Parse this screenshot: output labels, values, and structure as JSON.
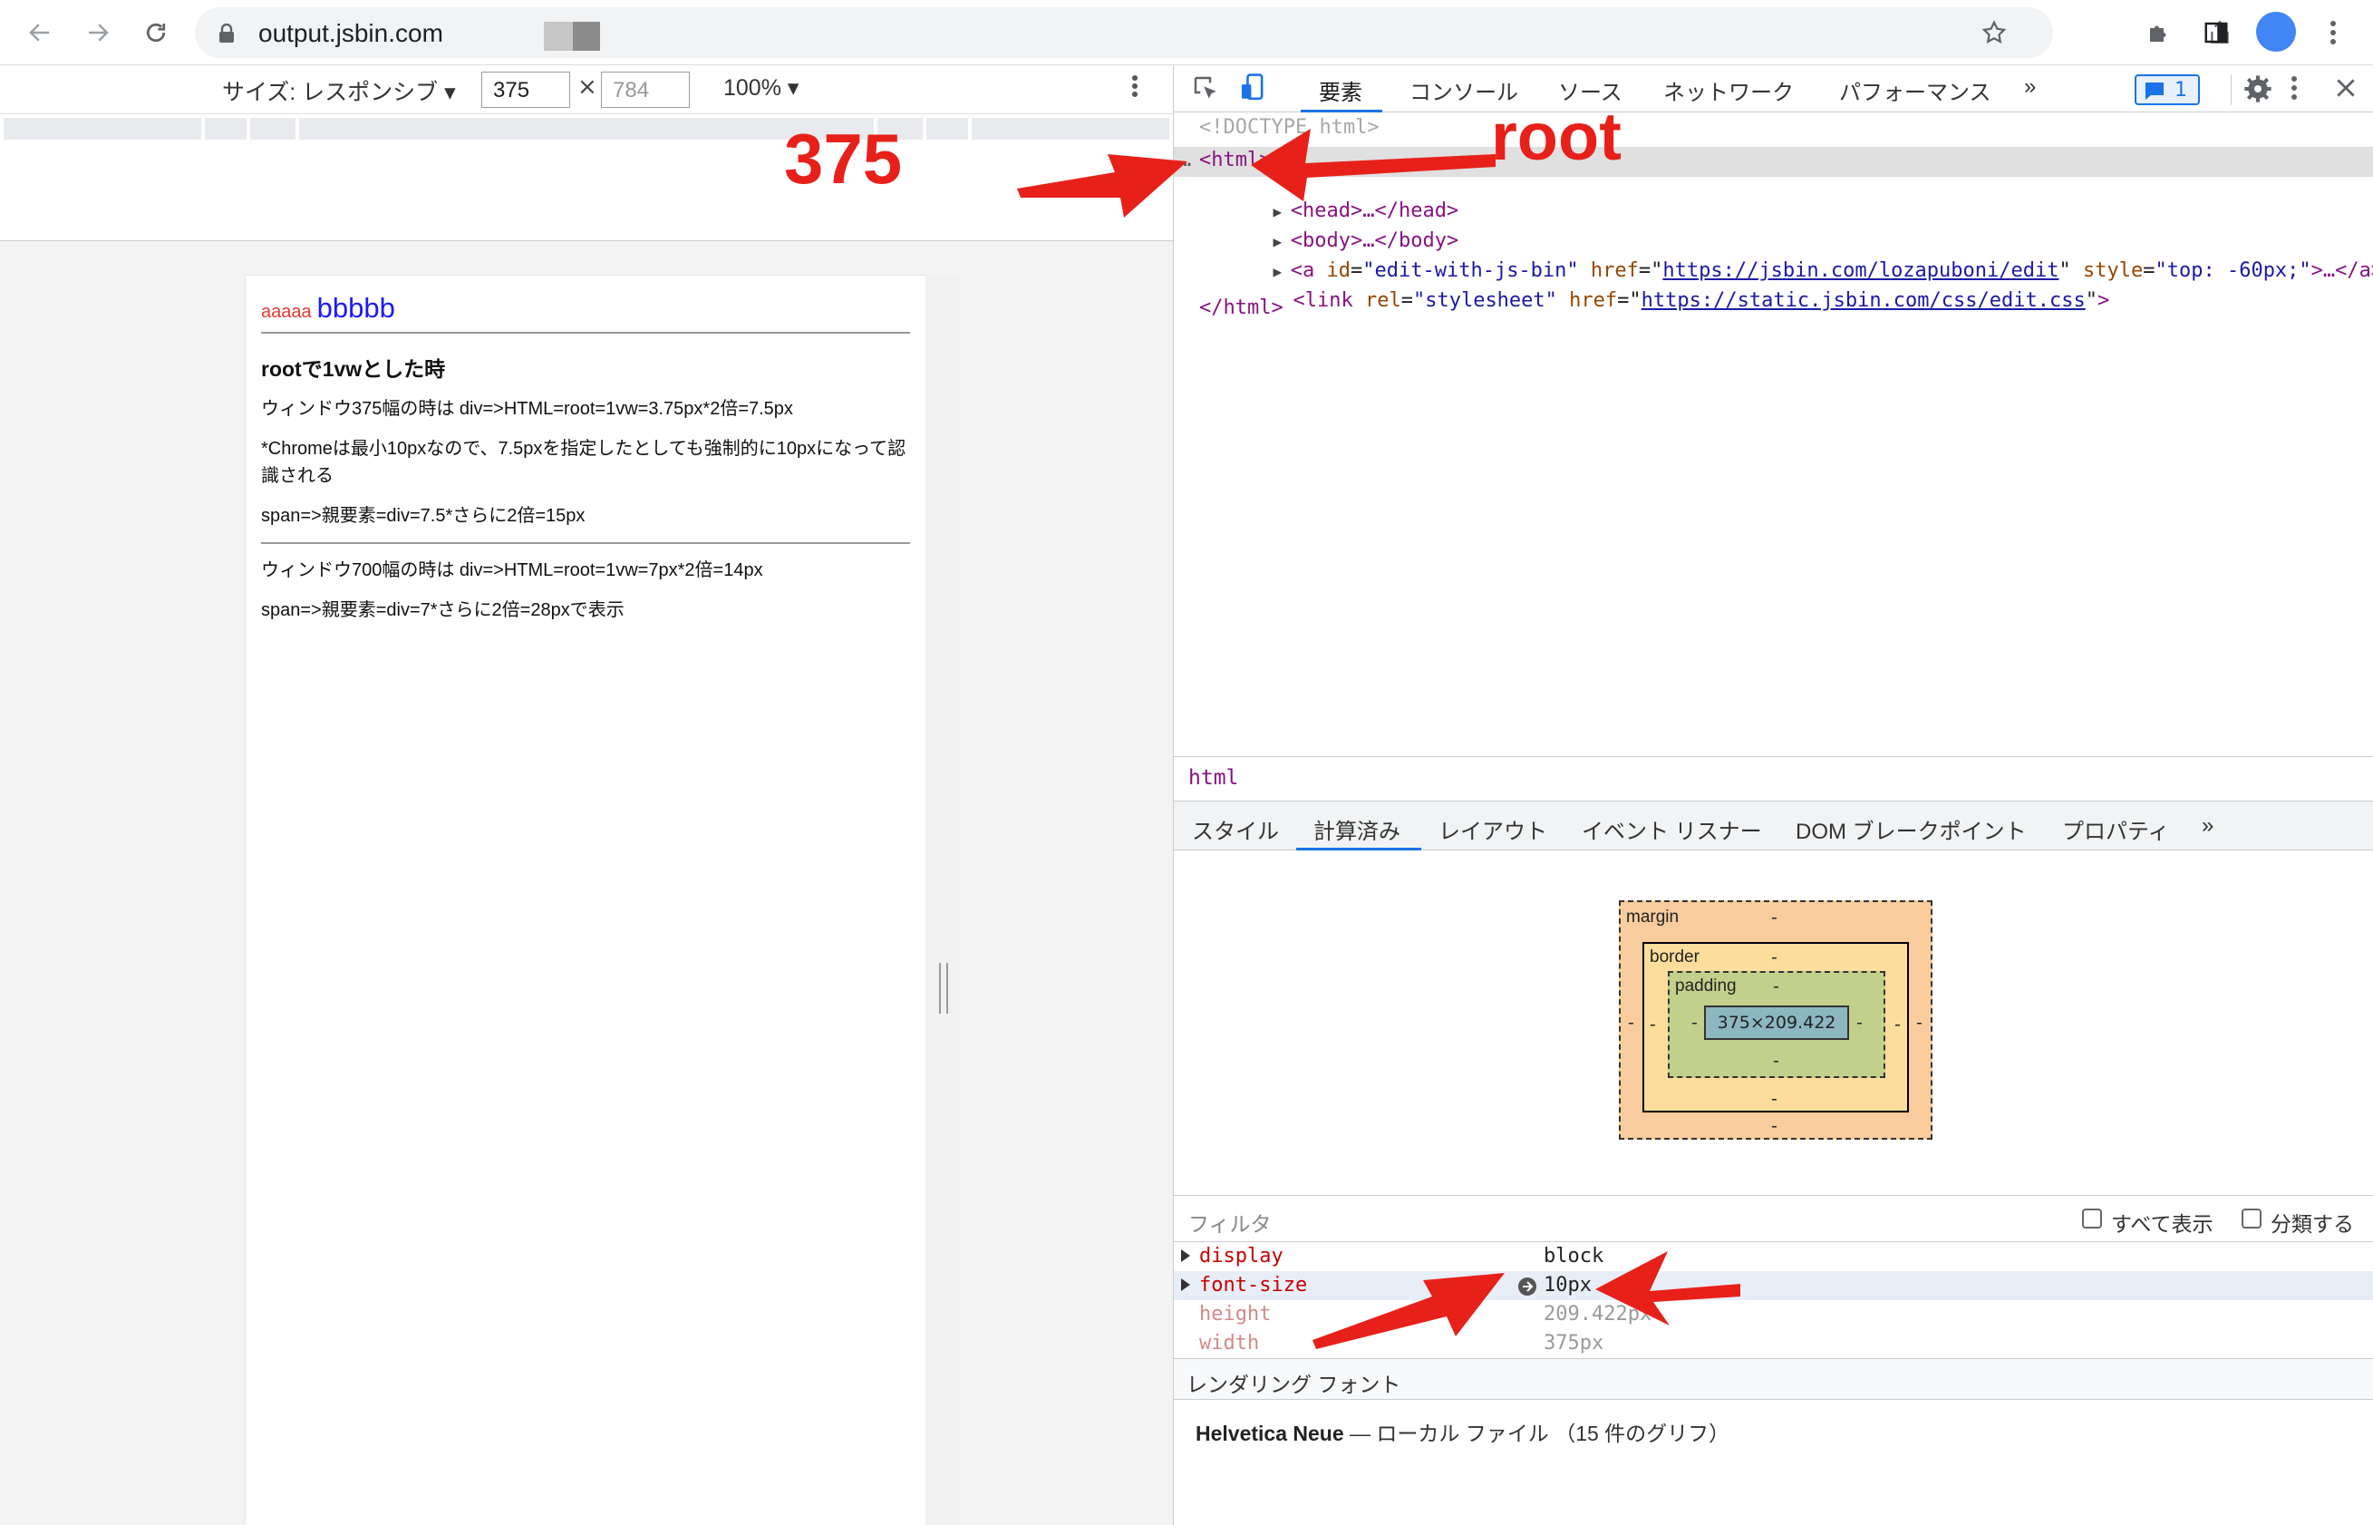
{
  "browser": {
    "url": "output.jsbin.com"
  },
  "device_toolbar": {
    "size_label": "サイズ: レスポンシブ ▾",
    "width": "375",
    "height_placeholder": "784",
    "times": "×",
    "zoom": "100% ▾"
  },
  "page": {
    "title_small": "aaaaa",
    "title_big": "bbbbb",
    "heading": "rootで1vwとした時",
    "line1": "ウィンドウ375幅の時は div=>HTML=root=1vw=3.75px*2倍=7.5px",
    "line2": "*Chromeは最小10pxなので、7.5pxを指定したとしても強制的に10pxになって認識される",
    "line3": "span=>親要素=div=7.5*さらに2倍=15px",
    "line4": "ウィンドウ700幅の時は div=>HTML=root=1vw=7px*2倍=14px",
    "line5": "span=>親要素=div=7*さらに2倍=28pxで表示"
  },
  "devtools": {
    "tabs": [
      "要素",
      "コンソール",
      "ソース",
      "ネットワーク",
      "パフォーマンス",
      "»"
    ],
    "issues_count": "1",
    "dom": {
      "doctype": "<!DOCTYPE html>",
      "html_open": "<html>",
      "head": "<head>…</head>",
      "body": "<body>…</body>",
      "a_prefix": "<a ",
      "a_id_attr": "id",
      "a_id_val": "\"edit-with-js-bin\"",
      "a_href_attr": "href",
      "a_href_val": "https://jsbin.com/lozapuboni/edit",
      "a_style_attr": "style",
      "a_style_val": "\"top: -60px;\"",
      "a_suffix": ">…</a>",
      "link_prefix": "<link ",
      "link_rel_attr": "rel",
      "link_rel_val": "\"stylesheet\"",
      "link_href_attr": "href",
      "link_href_val": "https://static.jsbin.com/css/edit.css",
      "link_suffix": ">",
      "html_close": "</html>"
    },
    "breadcrumb": "html",
    "subtabs": [
      "スタイル",
      "計算済み",
      "レイアウト",
      "イベント リスナー",
      "DOM ブレークポイント",
      "プロパティ",
      "»"
    ],
    "box_model": {
      "margin_label": "margin",
      "border_label": "border",
      "padding_label": "padding",
      "content": "375×209.422",
      "dash": "-"
    },
    "filter": {
      "placeholder": "フィルタ",
      "show_all": "すべて表示",
      "group": "分類する"
    },
    "computed": [
      {
        "name": "display",
        "value": "block"
      },
      {
        "name": "font-size",
        "value": "10px"
      },
      {
        "name": "height",
        "value": "209.422px"
      },
      {
        "name": "width",
        "value": "375px"
      }
    ],
    "rendered_fonts": {
      "heading": "レンダリング フォント",
      "font": "Helvetica Neue",
      "dash": "—",
      "detail": "ローカル ファイル （15 件のグリフ）"
    }
  },
  "annotations": {
    "label_375": "375",
    "label_root": "root",
    "color": "#e8201a"
  }
}
